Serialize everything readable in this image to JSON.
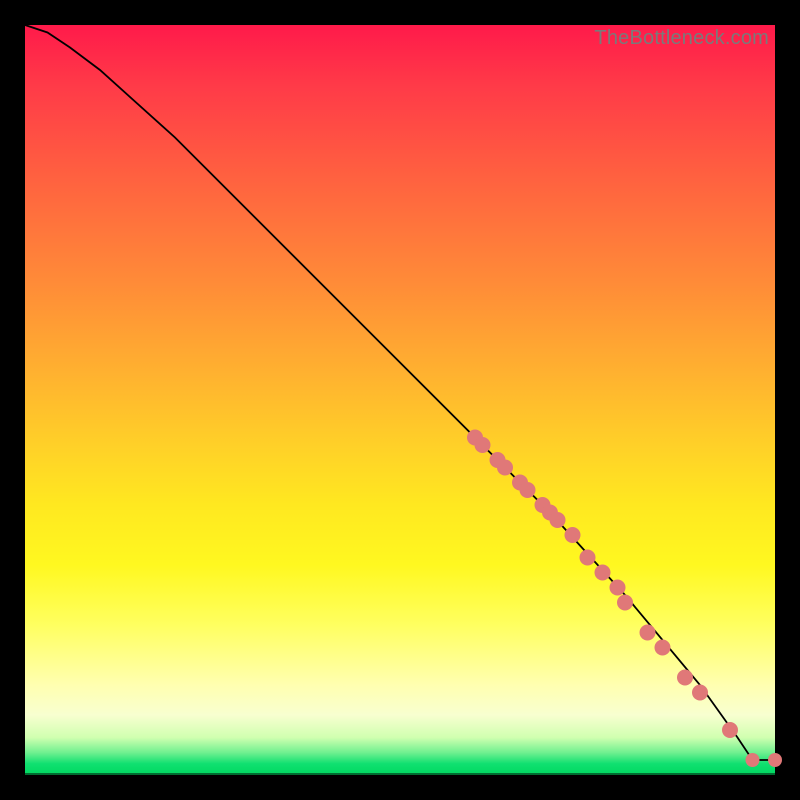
{
  "watermark": "TheBottleneck.com",
  "colors": {
    "gradient_top": "#ff1a4a",
    "gradient_mid": "#ffe820",
    "gradient_bottom": "#00d860",
    "curve": "#000000",
    "dots": "#e07878",
    "frame": "#000000"
  },
  "chart_data": {
    "type": "line",
    "title": "",
    "xlabel": "",
    "ylabel": "",
    "xlim": [
      0,
      100
    ],
    "ylim": [
      0,
      100
    ],
    "curve": {
      "x": [
        0,
        3,
        6,
        10,
        20,
        30,
        40,
        50,
        60,
        70,
        80,
        90,
        95,
        97,
        100
      ],
      "y": [
        100,
        99,
        97,
        94,
        85,
        75,
        65,
        55,
        45,
        35,
        24,
        12,
        5,
        2,
        2
      ]
    },
    "series": [
      {
        "name": "points-on-curve",
        "x": [
          60,
          61,
          63,
          64,
          66,
          67,
          69,
          70,
          71,
          73,
          75,
          77,
          79,
          80,
          83,
          85,
          88,
          90,
          94
        ],
        "y": [
          45,
          44,
          42,
          41,
          39,
          38,
          36,
          35,
          34,
          32,
          29,
          27,
          25,
          23,
          19,
          17,
          13,
          11,
          6
        ]
      },
      {
        "name": "bottom-points",
        "x": [
          97,
          100
        ],
        "y": [
          2,
          2
        ]
      }
    ],
    "legend": false,
    "grid": false
  }
}
